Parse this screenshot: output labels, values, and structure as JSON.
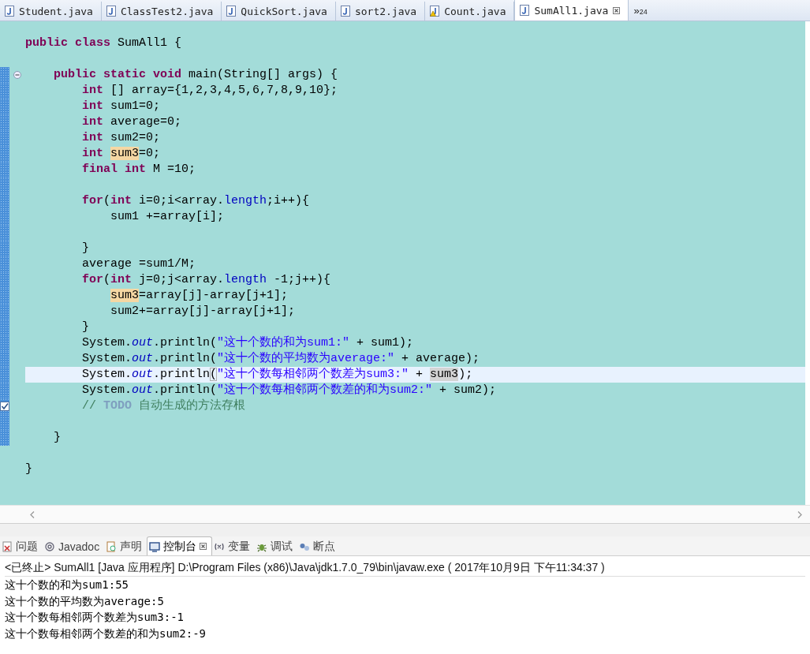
{
  "editor_tabs": [
    {
      "label": "Student.java",
      "kind": "java",
      "selected": false
    },
    {
      "label": "ClassTest2.java",
      "kind": "java",
      "selected": false
    },
    {
      "label": "QuickSort.java",
      "kind": "java",
      "selected": false
    },
    {
      "label": "sort2.java",
      "kind": "java",
      "selected": false
    },
    {
      "label": "Count.java",
      "kind": "java-warning",
      "selected": false
    },
    {
      "label": "SumAll1.java",
      "kind": "java",
      "selected": true
    }
  ],
  "overflow_tabs": {
    "chevron": "»",
    "count": "24"
  },
  "code_lines": [
    {
      "kind": "code",
      "ranged": false,
      "current": false,
      "tokens": [
        {
          "kind": "keyword",
          "text": "public"
        },
        {
          "kind": "keyword",
          "text": " class"
        },
        {
          "kind": "plain",
          "text": " SumAll1 {"
        }
      ]
    },
    {
      "kind": "blank",
      "ranged": false,
      "current": false
    },
    {
      "kind": "fold",
      "ranged": true,
      "current": false,
      "tokens": [
        {
          "kind": "keyword",
          "text": "    public"
        },
        {
          "kind": "keyword",
          "text": " static"
        },
        {
          "kind": "keyword",
          "text": " void"
        },
        {
          "kind": "plain",
          "text": " main(String[] args) {"
        }
      ]
    },
    {
      "kind": "code",
      "ranged": true,
      "current": false,
      "tokens": [
        {
          "kind": "keyword",
          "text": "        int"
        },
        {
          "kind": "plain",
          "text": " [] array={1,2,3,4,5,6,7,8,9,10};"
        }
      ]
    },
    {
      "kind": "code",
      "ranged": true,
      "current": false,
      "tokens": [
        {
          "kind": "keyword",
          "text": "        int"
        },
        {
          "kind": "plain",
          "text": " sum1=0;"
        }
      ]
    },
    {
      "kind": "code",
      "ranged": true,
      "current": false,
      "tokens": [
        {
          "kind": "keyword",
          "text": "        int"
        },
        {
          "kind": "plain",
          "text": " average=0;"
        }
      ]
    },
    {
      "kind": "code",
      "ranged": true,
      "current": false,
      "tokens": [
        {
          "kind": "keyword",
          "text": "        int"
        },
        {
          "kind": "plain",
          "text": " sum2=0;"
        }
      ]
    },
    {
      "kind": "code",
      "ranged": true,
      "current": false,
      "tokens": [
        {
          "kind": "keyword",
          "text": "        int "
        },
        {
          "kind": "write-occurrence",
          "text": "sum3"
        },
        {
          "kind": "plain",
          "text": "=0;"
        }
      ]
    },
    {
      "kind": "code",
      "ranged": true,
      "current": false,
      "tokens": [
        {
          "kind": "keyword",
          "text": "        final"
        },
        {
          "kind": "keyword",
          "text": " int"
        },
        {
          "kind": "plain",
          "text": " M =10;"
        }
      ]
    },
    {
      "kind": "blank",
      "ranged": true,
      "current": false
    },
    {
      "kind": "code",
      "ranged": true,
      "current": false,
      "tokens": [
        {
          "kind": "keyword",
          "text": "        for"
        },
        {
          "kind": "plain",
          "text": "("
        },
        {
          "kind": "keyword",
          "text": "int"
        },
        {
          "kind": "plain",
          "text": " i=0;i<array."
        },
        {
          "kind": "field",
          "text": "length"
        },
        {
          "kind": "plain",
          "text": ";i++){"
        }
      ]
    },
    {
      "kind": "code",
      "ranged": true,
      "current": false,
      "tokens": [
        {
          "kind": "plain",
          "text": "            sum1 +=array[i];"
        }
      ]
    },
    {
      "kind": "blank",
      "ranged": true,
      "current": false
    },
    {
      "kind": "code",
      "ranged": true,
      "current": false,
      "tokens": [
        {
          "kind": "plain",
          "text": "        }"
        }
      ]
    },
    {
      "kind": "code",
      "ranged": true,
      "current": false,
      "tokens": [
        {
          "kind": "plain",
          "text": "        average =sum1/M;"
        }
      ]
    },
    {
      "kind": "code",
      "ranged": true,
      "current": false,
      "tokens": [
        {
          "kind": "keyword",
          "text": "        for"
        },
        {
          "kind": "plain",
          "text": "("
        },
        {
          "kind": "keyword",
          "text": "int"
        },
        {
          "kind": "plain",
          "text": " j=0;j<array."
        },
        {
          "kind": "field",
          "text": "length"
        },
        {
          "kind": "plain",
          "text": " -1;j++){"
        }
      ]
    },
    {
      "kind": "code",
      "ranged": true,
      "current": false,
      "tokens": [
        {
          "kind": "write-occurrence",
          "text": "            sum3"
        },
        {
          "kind": "plain",
          "text": "=array[j]-array[j+1];"
        }
      ]
    },
    {
      "kind": "code",
      "ranged": true,
      "current": false,
      "tokens": [
        {
          "kind": "plain",
          "text": "            sum2+=array[j]-array[j+1];"
        }
      ]
    },
    {
      "kind": "code",
      "ranged": true,
      "current": false,
      "tokens": [
        {
          "kind": "plain",
          "text": "        }"
        }
      ]
    },
    {
      "kind": "code",
      "ranged": true,
      "current": false,
      "tokens": [
        {
          "kind": "plain",
          "text": "        System."
        },
        {
          "kind": "static-field",
          "text": "out"
        },
        {
          "kind": "plain",
          "text": ".println("
        },
        {
          "kind": "string",
          "text": "\"这十个数的和为sum1:\""
        },
        {
          "kind": "plain",
          "text": " + sum1);"
        }
      ]
    },
    {
      "kind": "code",
      "ranged": true,
      "current": false,
      "tokens": [
        {
          "kind": "plain",
          "text": "        System."
        },
        {
          "kind": "static-field",
          "text": "out"
        },
        {
          "kind": "plain",
          "text": ".println("
        },
        {
          "kind": "string",
          "text": "\"这十个数的平均数为average:\""
        },
        {
          "kind": "plain",
          "text": " + average);"
        }
      ]
    },
    {
      "kind": "code",
      "ranged": true,
      "current": true,
      "tokens": [
        {
          "kind": "plain",
          "text": "        System."
        },
        {
          "kind": "static-field",
          "text": "out"
        },
        {
          "kind": "plain",
          "text": ".println"
        },
        {
          "kind": "matched-bracket",
          "text": "("
        },
        {
          "kind": "string",
          "text": "\"这十个数每相邻两个数差为sum3:\""
        },
        {
          "kind": "plain",
          "text": " + "
        },
        {
          "kind": "read-occurrence",
          "text": "sum3"
        },
        {
          "kind": "plain",
          "text": ");"
        }
      ]
    },
    {
      "kind": "code",
      "ranged": true,
      "current": false,
      "tokens": [
        {
          "kind": "plain",
          "text": "        System."
        },
        {
          "kind": "static-field",
          "text": "out"
        },
        {
          "kind": "plain",
          "text": ".println("
        },
        {
          "kind": "string",
          "text": "\"这十个数每相邻两个数差的和为sum2:\""
        },
        {
          "kind": "plain",
          "text": " + sum2);"
        }
      ]
    },
    {
      "kind": "task",
      "ranged": true,
      "current": false,
      "tokens": [
        {
          "kind": "comment",
          "text": "        // "
        },
        {
          "kind": "task-tag",
          "text": "TODO"
        },
        {
          "kind": "comment",
          "text": " 自动生成的方法存根"
        }
      ]
    },
    {
      "kind": "blank",
      "ranged": true,
      "current": false
    },
    {
      "kind": "code",
      "ranged": true,
      "current": false,
      "tokens": [
        {
          "kind": "plain",
          "text": "    }"
        }
      ]
    },
    {
      "kind": "blank",
      "ranged": false,
      "current": false
    },
    {
      "kind": "code",
      "ranged": false,
      "current": false,
      "tokens": [
        {
          "kind": "plain",
          "text": "}"
        }
      ]
    }
  ],
  "view_tabs": [
    {
      "label": "问题",
      "kind": "problems",
      "selected": false
    },
    {
      "label": "Javadoc",
      "kind": "javadoc",
      "selected": false
    },
    {
      "label": "声明",
      "kind": "declaration",
      "selected": false
    },
    {
      "label": "控制台",
      "kind": "console",
      "selected": true
    },
    {
      "label": "变量",
      "kind": "variables",
      "selected": false
    },
    {
      "label": "调试",
      "kind": "debug",
      "selected": false
    },
    {
      "label": "断点",
      "kind": "breakpoints",
      "selected": false
    }
  ],
  "console": {
    "header": "<已终止> SumAll1 [Java 应用程序] D:\\Program Files (x86)\\Java\\jdk1.7.0_79\\bin\\javaw.exe ( 2017年10月9日 下午11:34:37 )",
    "output": [
      "这十个数的和为sum1:55",
      "这十个数的平均数为average:5",
      "这十个数每相邻两个数差为sum3:-1",
      "这十个数每相邻两个数差的和为sum2:-9"
    ]
  }
}
